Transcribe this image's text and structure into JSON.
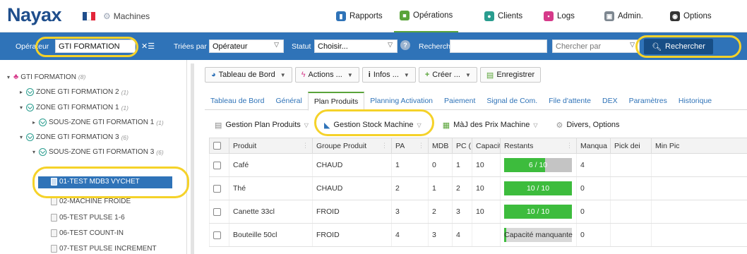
{
  "header": {
    "logo": "Nayax",
    "flag_colors": [
      "#1f4e8c",
      "#ffffff",
      "#e3263a"
    ],
    "app_title": "Machines",
    "nav": [
      {
        "label": "Rapports",
        "icon": "chart-icon",
        "color": "#2f73b8"
      },
      {
        "label": "Opérations",
        "icon": "operations-icon",
        "color": "#5aa43a",
        "active": true
      },
      {
        "label": "Clients",
        "icon": "clients-icon",
        "color": "#2a9d8f"
      },
      {
        "label": "Logs",
        "icon": "logs-icon",
        "color": "#d63a8a"
      },
      {
        "label": "Admin.",
        "icon": "admin-icon",
        "color": "#7d8790"
      },
      {
        "label": "Options",
        "icon": "options-icon",
        "color": "#333333"
      }
    ]
  },
  "filter": {
    "operator_label": "Opérateur",
    "operator_value": "GTI FORMATION",
    "sort_label": "Triées par",
    "sort_value": "Opérateur",
    "status_label": "Statut",
    "status_value": "Choisir...",
    "search_label": "Rechercher",
    "search_value": "",
    "search_by_placeholder": "Chercher par",
    "search_button": "Rechercher"
  },
  "tree": {
    "root": {
      "label": "GTI FORMATION",
      "count": "(8)"
    },
    "items": [
      {
        "label": "ZONE GTI FORMATION 2",
        "count": "(1)",
        "type": "zone",
        "expanded": false
      },
      {
        "label": "ZONE GTI FORMATION 1",
        "count": "(1)",
        "type": "zone",
        "expanded": true
      },
      {
        "label": "SOUS-ZONE GTI FORMATION 1",
        "count": "(1)",
        "type": "zone",
        "expanded": false
      },
      {
        "label": "ZONE GTI FORMATION 3",
        "count": "(6)",
        "type": "zone",
        "expanded": true
      },
      {
        "label": "SOUS-ZONE GTI FORMATION 3",
        "count": "(6)",
        "type": "zone",
        "expanded": true
      },
      {
        "label": "01-TEST MDB3 VYCHET",
        "type": "machine",
        "selected": true
      },
      {
        "label": "02-MACHINE FROIDE",
        "type": "machine"
      },
      {
        "label": "05-TEST PULSE 1-6",
        "type": "machine"
      },
      {
        "label": "06-TEST COUNT-IN",
        "type": "machine"
      },
      {
        "label": "07-TEST PULSE INCREMENT",
        "type": "machine"
      }
    ]
  },
  "toolbar": {
    "dashboard": "Tableau de Bord",
    "actions": "Actions ...",
    "infos": "Infos ...",
    "create": "Créer ...",
    "save": "Enregistrer"
  },
  "tabs": [
    "Tableau de Bord",
    "Général",
    "Plan Produits",
    "Planning Activation",
    "Paiement",
    "Signal de Com.",
    "File d'attente",
    "DEX",
    "Paramètres",
    "Historique"
  ],
  "active_tab": "Plan Produits",
  "subtoolbar": {
    "plan": "Gestion Plan Produits",
    "stock": "Gestion Stock Machine",
    "prices": "MàJ des Prix Machine",
    "misc": "Divers, Options"
  },
  "grid": {
    "columns": [
      "Produit",
      "Groupe Produit",
      "PA",
      "MDB",
      "PC (",
      "Capacit",
      "Restants",
      "Manqua",
      "Pick dei",
      "Min Pic"
    ],
    "rows": [
      {
        "produit": "Café",
        "groupe": "CHAUD",
        "pa": "1",
        "mdb": "0",
        "pc": "1",
        "capacite": "10",
        "restants_text": "6 / 10",
        "restants_fill": 0.6,
        "manquant": "4"
      },
      {
        "produit": "Thé",
        "groupe": "CHAUD",
        "pa": "2",
        "mdb": "1",
        "pc": "2",
        "capacite": "10",
        "restants_text": "10 / 10",
        "restants_fill": 1.0,
        "manquant": "0"
      },
      {
        "produit": "Canette 33cl",
        "groupe": "FROID",
        "pa": "3",
        "mdb": "2",
        "pc": "3",
        "capacite": "10",
        "restants_text": "10 / 10",
        "restants_fill": 1.0,
        "manquant": "0"
      },
      {
        "produit": "Bouteille 50cl",
        "groupe": "FROID",
        "pa": "4",
        "mdb": "3",
        "pc": "4",
        "capacite": "",
        "restants_text": "Capacité manquante",
        "restants_fill": 0,
        "manquant": "0"
      }
    ]
  }
}
